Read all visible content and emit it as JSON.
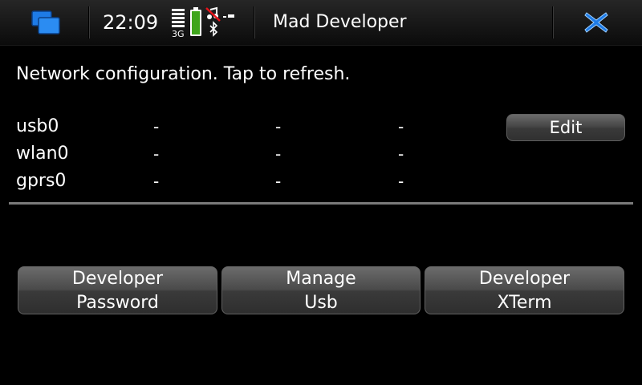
{
  "statusbar": {
    "switcher_icon": "task-switcher-icon",
    "time": "22:09",
    "network_type": "3G",
    "battery_icon": "battery-icon",
    "signal_icon": "signal-strength-icon",
    "mute_icon": "silent-profile-icon",
    "bluetooth_icon": "bluetooth-icon",
    "usb_icon": "usb-icon",
    "app_title": "Mad Developer",
    "close_icon": "close-icon",
    "accent": "#1e7be6"
  },
  "network": {
    "heading": "Network configuration. Tap to refresh.",
    "interfaces": [
      {
        "name": "usb0",
        "col1": "-",
        "col2": "-",
        "col3": "-"
      },
      {
        "name": "wlan0",
        "col1": "-",
        "col2": "-",
        "col3": "-"
      },
      {
        "name": "gprs0",
        "col1": "-",
        "col2": "-",
        "col3": "-"
      }
    ],
    "edit_label": "Edit"
  },
  "actions": [
    {
      "line1": "Developer",
      "line2": "Password"
    },
    {
      "line1": "Manage",
      "line2": "Usb"
    },
    {
      "line1": "Developer",
      "line2": "XTerm"
    }
  ]
}
